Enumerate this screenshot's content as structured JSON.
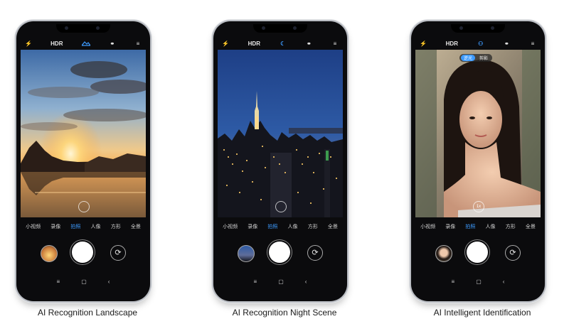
{
  "panels": [
    {
      "caption": "AI Recognition Landscape",
      "modes": [
        "小视频",
        "录像",
        "拍照",
        "人像",
        "方形",
        "全景"
      ],
      "selected_mode": "拍照",
      "topbar": {
        "flash": "⚡",
        "hdr": "HDR",
        "ai": "AI",
        "filter": "⚭",
        "menu": "≡"
      },
      "active_ai_icon": "landscape-icon"
    },
    {
      "caption": "AI Recognition Night Scene",
      "modes": [
        "小视频",
        "录像",
        "拍照",
        "人像",
        "方形",
        "全景"
      ],
      "selected_mode": "拍照",
      "topbar": {
        "flash": "⚡",
        "hdr": "HDR",
        "ai": "☾",
        "filter": "⚭",
        "menu": "≡"
      },
      "active_ai_icon": "night-icon"
    },
    {
      "caption": "AI Intelligent Identification",
      "modes": [
        "小视频",
        "录像",
        "拍照",
        "人像",
        "方形",
        "全景"
      ],
      "selected_mode": "拍照",
      "topbar": {
        "flash": "⚡",
        "hdr": "HDR",
        "ai": "⚇",
        "filter": "⚭",
        "menu": "≡"
      },
      "active_ai_icon": "portrait-icon",
      "chip": {
        "on": "逆光",
        "off": "剪影"
      },
      "focus_label": "1x"
    }
  ],
  "navbar": {
    "menu": "≡",
    "home": "▢",
    "back": "‹"
  },
  "colors": {
    "accent": "#3d9bff",
    "phone_body": "#0b0b0d"
  }
}
